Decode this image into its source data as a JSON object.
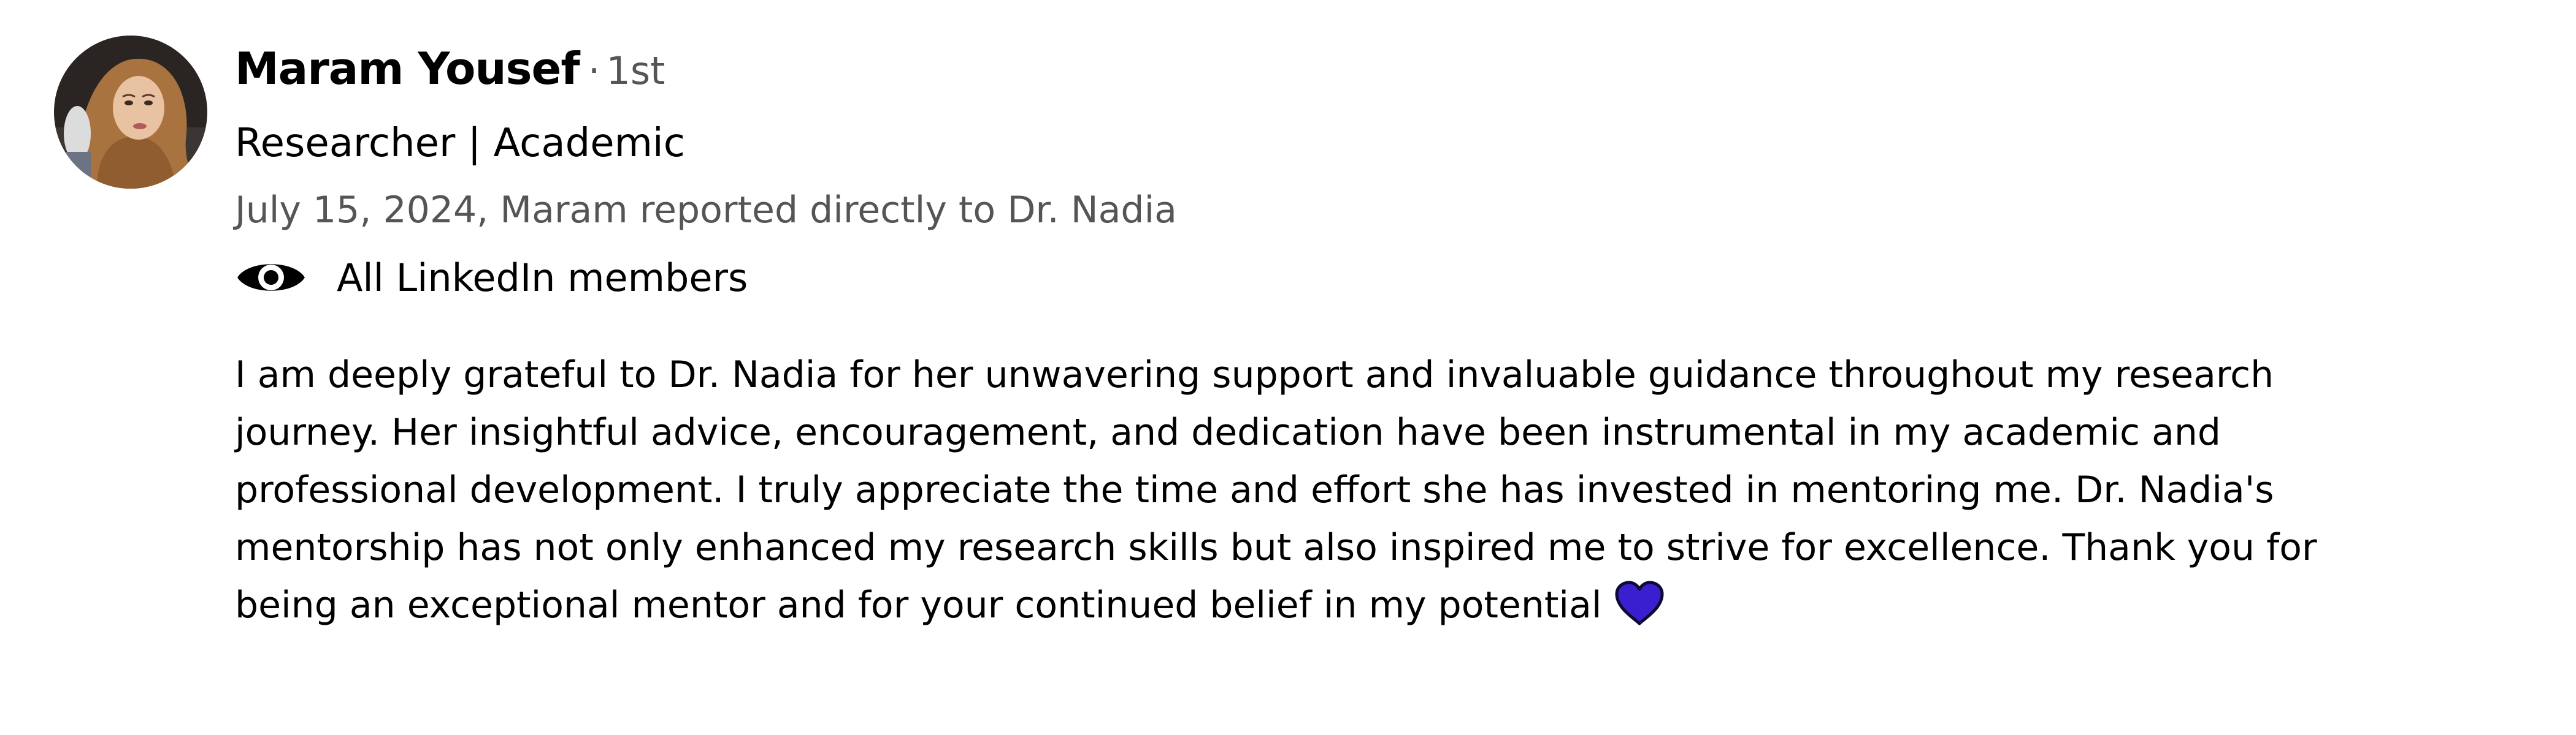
{
  "post": {
    "author": {
      "name": "Maram Yousef",
      "degree_separator": "·",
      "degree": "1st",
      "headline": "Researcher | Academic",
      "avatar_icon": "profile-photo-woman-hijab"
    },
    "meta": "July 15, 2024, Maram reported directly to Dr. Nadia",
    "visibility": {
      "icon": "eye-icon",
      "label": "All LinkedIn members"
    },
    "body_lines": [
      "I am deeply grateful to Dr. Nadia for her unwavering support and invaluable guidance throughout my research",
      "journey. Her insightful advice, encouragement, and dedication have been instrumental in my academic and",
      "professional development. I truly appreciate the time and effort she has invested in mentoring me. Dr. Nadia's",
      "mentorship has not only enhanced my research skills but also inspired me to strive for excellence. Thank you for",
      "being an exceptional mentor and for your continued belief in my potential"
    ],
    "emoji": {
      "icon": "purple-heart-icon",
      "color": "#3a1fd1"
    }
  }
}
